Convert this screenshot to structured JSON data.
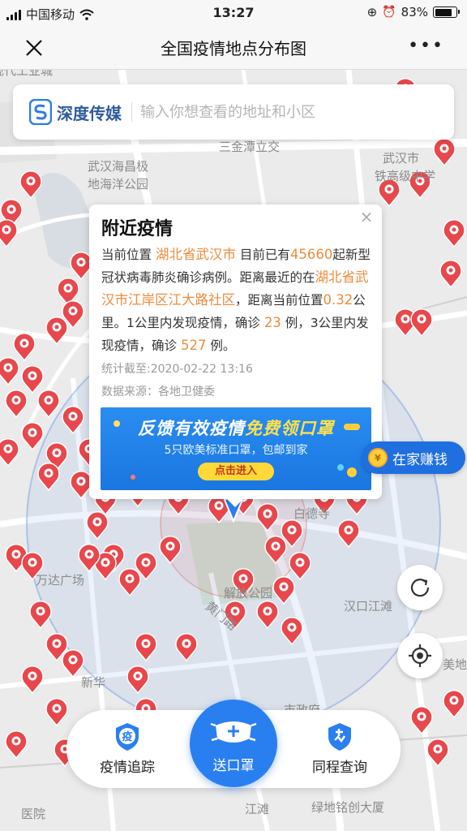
{
  "status": {
    "carrier": "中国移动",
    "time": "13:27",
    "battery": "83%",
    "battery_level": 0.83
  },
  "nav": {
    "title": "全国疫情地点分布图",
    "close_icon": "close-icon",
    "more_icon": "more-icon"
  },
  "search": {
    "brand": "深度传媒",
    "placeholder": "输入你想查看的地址和小区"
  },
  "map_labels": {
    "l1": "三金潭立交",
    "l2": "武汉海昌极",
    "l3": "地海洋公园",
    "l4": "武汉市",
    "l5": "铁高级中学",
    "l6": "万达广场",
    "l7": "白德寺",
    "l8": "解放公园",
    "l9": "黄门路",
    "l10": "汉口江滩",
    "l11": "市政府",
    "l12": "绿地铭创大厦",
    "l13": "江滩",
    "l14": "医院",
    "l15": "新华",
    "l16": "美地",
    "l17": "现代工业城"
  },
  "popup": {
    "title": "附近疫情",
    "t1": "当前位置",
    "location": "湖北省武汉市",
    "t2": "目前已有",
    "total": "45660",
    "t3": "起新型冠状病毒肺炎确诊病例。距离最近的在",
    "nearest": "湖北省武汉市江岸区江大路社区",
    "t4": "，距离当前位置",
    "distance": "0.32",
    "t5": "公里。1公里内发现疫情，确诊",
    "cases_1km": "23",
    "t6": "例，3公里内发现疫情，确诊",
    "cases_3km": "527",
    "t7": "例。",
    "stats_time": "统计截至:2020-02-22 13:16",
    "source": "数据来源：各地卫健委",
    "close": "×"
  },
  "banner": {
    "title_a": "反馈有效疫情",
    "title_b": "免费领口罩",
    "subtitle": "5只欧美标准口罩，包邮到家",
    "button": "点击进入"
  },
  "earn": {
    "label": "在家赚钱",
    "coin": "¥"
  },
  "bottom_nav": {
    "left": "疫情追踪",
    "left_icon_text": "疫",
    "center": "送口罩",
    "right": "同程查询"
  },
  "colors": {
    "accent": "#2a7ff0",
    "highlight": "#ef8b3b",
    "marker": "#e8474c"
  }
}
